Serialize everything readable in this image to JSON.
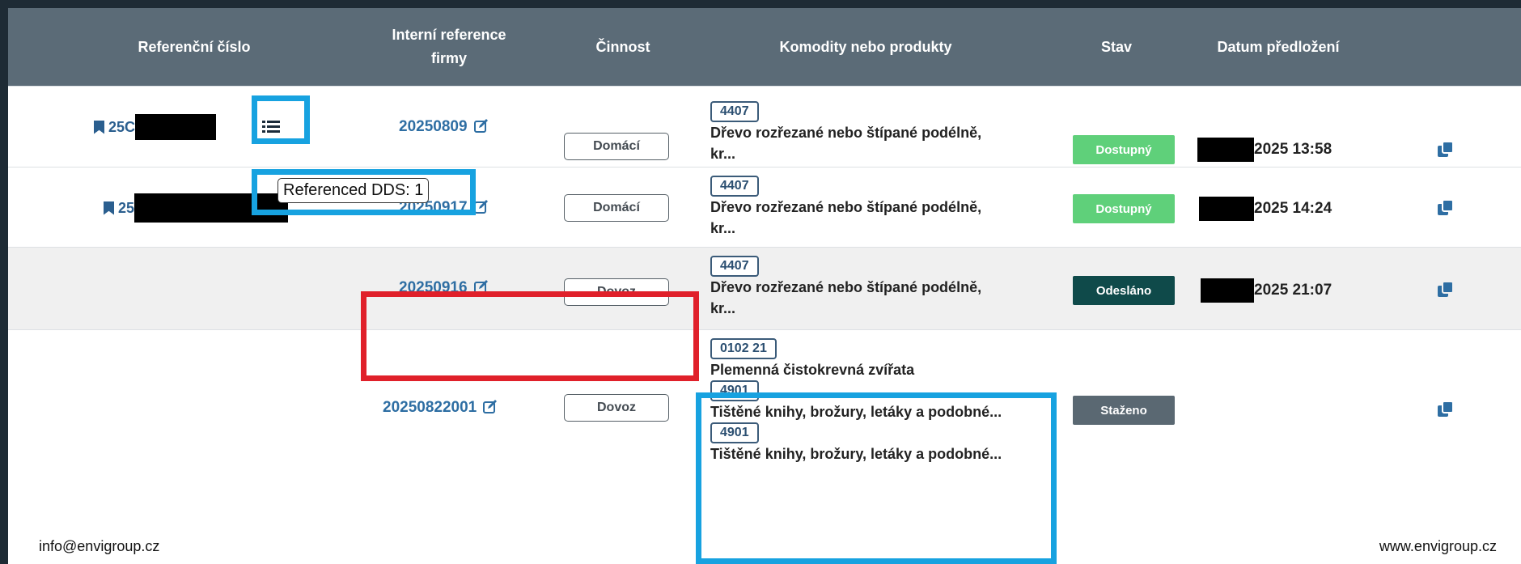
{
  "table": {
    "headers": {
      "ref": "Referenční číslo",
      "intref_1": "Interní reference",
      "intref_2": "firmy",
      "activity": "Činnost",
      "commodities": "Komodity nebo produkty",
      "status": "Stav",
      "date": "Datum předložení"
    },
    "rows": [
      {
        "ref_prefix": "25C",
        "intref": "20250809",
        "activity": "Domácí",
        "items": [
          {
            "code": "4407",
            "text_1": "Dřevo rozřezané nebo štípané podélně,",
            "text_2": "kr..."
          }
        ],
        "status": "Dostupný",
        "date_suffix": "2025 13:58"
      },
      {
        "ref_prefix": "25",
        "intref": "20250917",
        "activity": "Domácí",
        "items": [
          {
            "code": "4407",
            "text_1": "Dřevo rozřezané nebo štípané podélně,",
            "text_2": "kr..."
          }
        ],
        "status": "Dostupný",
        "date_suffix": "2025 14:24"
      },
      {
        "ref_prefix": "",
        "intref": "20250916",
        "activity": "Dovoz",
        "items": [
          {
            "code": "4407",
            "text_1": "Dřevo rozřezané nebo štípané podélně,",
            "text_2": "kr..."
          }
        ],
        "status": "Odesláno",
        "date_suffix": "2025 21:07"
      },
      {
        "ref_prefix": "",
        "intref": "20250822001",
        "activity": "Dovoz",
        "items": [
          {
            "code": "0102 21",
            "text_1": "Plemenná čistokrevná zvířata"
          },
          {
            "code": "4901",
            "text_1": "Tištěné knihy, brožury, letáky a podobné..."
          },
          {
            "code": "4901",
            "text_1": "Tištěné knihy, brožury, letáky a podobné..."
          }
        ],
        "status": "Staženo",
        "date_suffix": ""
      }
    ]
  },
  "tooltip": "Referenced DDS: 1",
  "footer": {
    "email": "info@envigroup.cz",
    "web": "www.envigroup.cz"
  },
  "colors": {
    "header_bg": "#5b6b77",
    "status_available": "#5fd07a",
    "status_sent": "#0f4a4a",
    "status_withdrawn": "#5a6872",
    "highlight_blue": "#17a2e0",
    "highlight_red": "#e0202a",
    "link": "#2e6ea3"
  },
  "icons": [
    "bookmark-icon",
    "edit-icon",
    "list-icon",
    "copy-icon"
  ]
}
